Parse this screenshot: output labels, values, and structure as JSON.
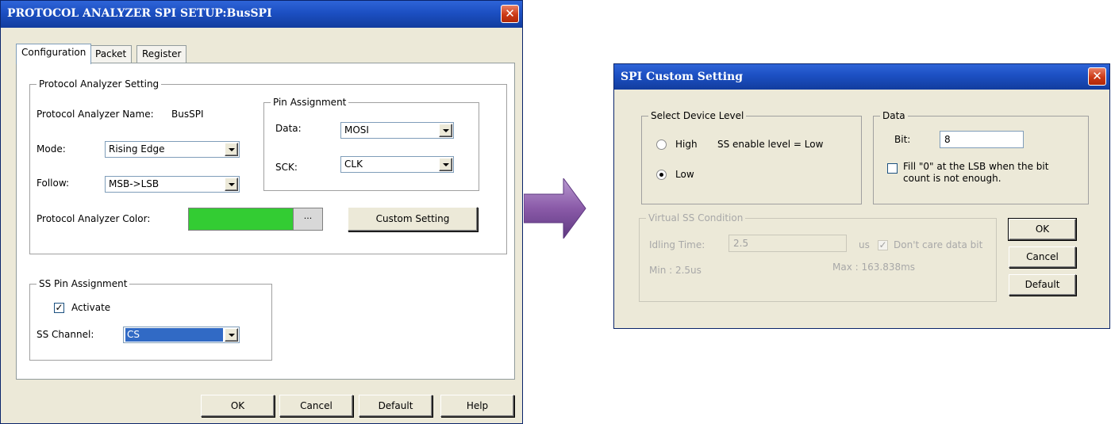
{
  "spi_setup": {
    "title": "PROTOCOL ANALYZER SPI SETUP:BusSPI",
    "close_glyph": "✕",
    "tabs": [
      {
        "label": "Configuration",
        "active": true
      },
      {
        "label": "Packet",
        "active": false
      },
      {
        "label": "Register",
        "active": false
      }
    ],
    "protocol_group": {
      "legend": "Protocol Analyzer Setting",
      "name_label": "Protocol Analyzer Name:",
      "name_value": "BusSPI",
      "mode_label": "Mode:",
      "mode_value": "Rising Edge",
      "follow_label": "Follow:",
      "follow_value": "MSB->LSB",
      "color_label": "Protocol Analyzer Color:",
      "color_value": "#33cc33",
      "color_more_label": "···",
      "custom_setting_label": "Custom Setting"
    },
    "pin_group": {
      "legend": "Pin Assignment",
      "data_label": "Data:",
      "data_value": "MOSI",
      "sck_label": "SCK:",
      "sck_value": "CLK"
    },
    "ss_group": {
      "legend": "SS Pin Assignment",
      "activate_label": "Activate",
      "activate_checked": true,
      "check_glyph": "✓",
      "channel_label": "SS Channel:",
      "channel_value": "CS"
    },
    "buttons": {
      "ok": "OK",
      "cancel": "Cancel",
      "default": "Default",
      "help": "Help"
    }
  },
  "arrow": {
    "icon": "arrow-right-icon",
    "color": "#8a5aa8"
  },
  "custom_setting": {
    "title": "SPI Custom Setting",
    "close_glyph": "✕",
    "device_level": {
      "legend": "Select Device Level",
      "high_label": "High",
      "low_label": "Low",
      "selected": "Low",
      "enable_text": "SS enable level  = Low"
    },
    "data_group": {
      "legend": "Data",
      "bit_label": "Bit:",
      "bit_value": "8",
      "fill_line1": "Fill \"0\" at the LSB when the bit",
      "fill_line2": "count is not enough.",
      "fill_checked": false
    },
    "virtual_ss": {
      "legend": "Virtual  SS Condition",
      "idling_label": "Idling Time:",
      "idling_value": "2.5",
      "unit": "us",
      "dont_care_label": "Don't care data bit",
      "dont_care_checked": true,
      "min_text": "Min : 2.5us",
      "max_text": "Max : 163.838ms"
    },
    "buttons": {
      "ok": "OK",
      "cancel": "Cancel",
      "default": "Default"
    }
  }
}
